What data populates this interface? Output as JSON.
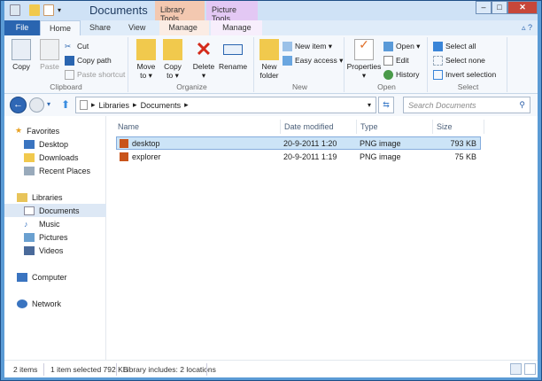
{
  "window": {
    "title": "Documents",
    "context_tabs": [
      "Library Tools",
      "Picture Tools"
    ],
    "controls": {
      "minimize": "–",
      "maximize": "□",
      "close": "✕"
    }
  },
  "tabs": [
    "File",
    "Home",
    "Share",
    "View",
    "Manage",
    "Manage"
  ],
  "ribbon": {
    "clipboard": {
      "label": "Clipboard",
      "copy": "Copy",
      "paste": "Paste",
      "cut": "Cut",
      "copy_path": "Copy path",
      "paste_shortcut": "Paste shortcut"
    },
    "organize": {
      "label": "Organize",
      "move_to": "Move to ▾",
      "copy_to": "Copy to ▾",
      "delete": "Delete ▾",
      "rename": "Rename"
    },
    "new": {
      "label": "New",
      "new_folder": "New folder",
      "new_item": "New item ▾",
      "easy_access": "Easy access ▾"
    },
    "open": {
      "label": "Open",
      "properties": "Properties ▾",
      "open": "Open ▾",
      "edit": "Edit",
      "history": "History"
    },
    "select": {
      "label": "Select",
      "select_all": "Select all",
      "select_none": "Select none",
      "invert": "Invert selection"
    }
  },
  "address": {
    "crumbs": [
      "Libraries",
      "Documents"
    ],
    "search_placeholder": "Search Documents"
  },
  "nav": {
    "favorites": "Favorites",
    "fav_items": [
      "Desktop",
      "Downloads",
      "Recent Places"
    ],
    "libraries": "Libraries",
    "lib_items": [
      "Documents",
      "Music",
      "Pictures",
      "Videos"
    ],
    "computer": "Computer",
    "network": "Network"
  },
  "columns": [
    "Name",
    "Date modified",
    "Type",
    "Size"
  ],
  "files": [
    {
      "name": "desktop",
      "date": "20-9-2011 1:20",
      "type": "PNG image",
      "size": "793 KB"
    },
    {
      "name": "explorer",
      "date": "20-9-2011 1:19",
      "type": "PNG image",
      "size": "75 KB"
    }
  ],
  "status": {
    "items": "2 items",
    "selected": "1 item selected  792 KB",
    "library": "Library includes: 2 locations"
  }
}
